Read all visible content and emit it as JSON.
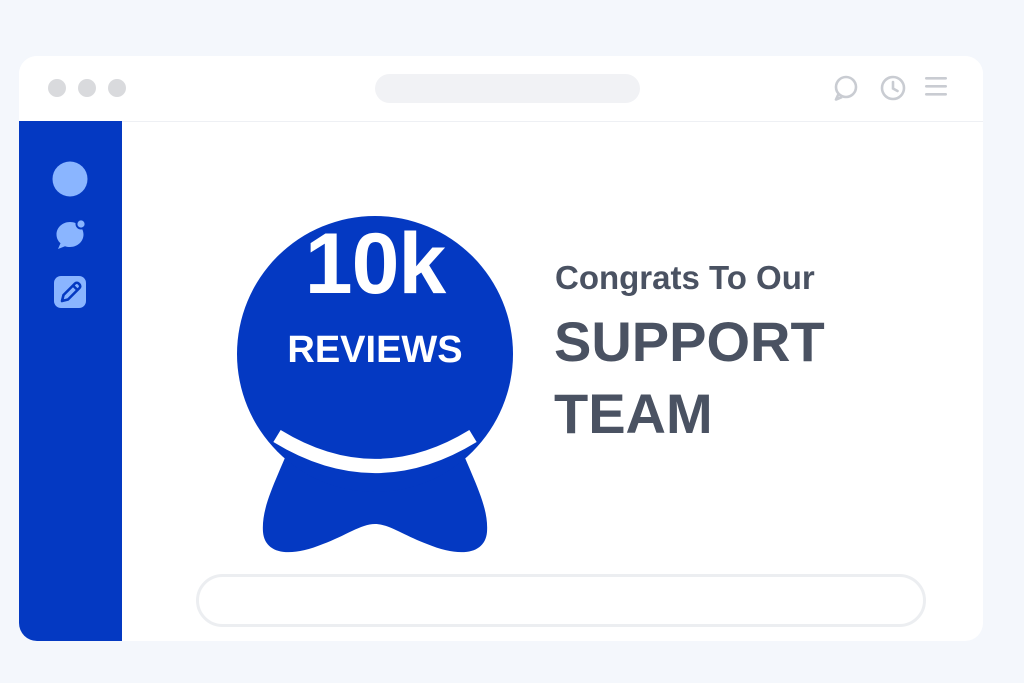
{
  "window": {
    "controls": [
      "close",
      "minimize",
      "maximize"
    ],
    "toolbar_icons": [
      "search-icon",
      "clock-icon",
      "menu-icon"
    ]
  },
  "sidebar": {
    "icons": [
      "avatar-circle-icon",
      "chat-bubble-icon",
      "edit-icon"
    ],
    "color": "#0439c2"
  },
  "badge": {
    "count": "10k",
    "label": "REVIEWS",
    "color": "#0439c2"
  },
  "message": {
    "intro": "Congrats To Our",
    "line1": "SUPPORT",
    "line2": "TEAM",
    "color": "#4a5262"
  },
  "input": {
    "value": ""
  }
}
